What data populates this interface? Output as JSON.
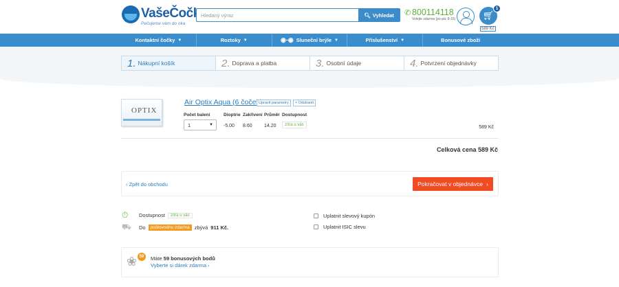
{
  "header": {
    "logo_text": "VašeČočky",
    "logo_tagline": "Pečujeme vám do oka",
    "search_placeholder": "Hledaný výraz",
    "search_button": "Vyhledat",
    "phone_number": "800114118",
    "phone_note": "Volejte zdarma (po-pá: 8-16)",
    "cart_count": "1",
    "cart_price": "589 Kč"
  },
  "nav": {
    "items": [
      "Kontaktní čočky",
      "Roztoky",
      "Sluneční brýle",
      "Příslušenství",
      "Bonusové zboží"
    ]
  },
  "steps": [
    {
      "num": "1.",
      "label": "Nákupní košík"
    },
    {
      "num": "2.",
      "label": "Doprava a platba"
    },
    {
      "num": "3.",
      "label": "Osobní údaje"
    },
    {
      "num": "4.",
      "label": "Potvrzení objednávky"
    }
  ],
  "product": {
    "image_text": "OPTIX",
    "name": "Air Optix Aqua (6 čoček)",
    "edit_label": "Upravit parametry",
    "remove_label": "× Odstranit",
    "labels": {
      "quantity": "Počet balení",
      "dioptrie": "Dioptrie",
      "zakriveni": "Zakřivení",
      "prumer": "Průměr",
      "dostupnost": "Dostupnost"
    },
    "quantity": "1",
    "dioptrie": "-5.00",
    "zakriveni": "8.60",
    "prumer": "14.20",
    "availability": "zítra u vás",
    "price": "589 Kč"
  },
  "total": "Celková cena 589 Kč",
  "actions": {
    "back": "‹ Zpět do obchodu",
    "continue": "Pokračovat v objednávce"
  },
  "info": {
    "availability_label": "Dostupnost",
    "availability_value": "zítra u vás",
    "shipping_prefix": "Do",
    "shipping_highlight": "poštovného zdarma",
    "shipping_suffix": "zbývá",
    "shipping_amount": "911 Kč.",
    "coupon": "Uplatnit slevový kupón",
    "isic": "Uplatnit ISIC slevu"
  },
  "bonus": {
    "count": "59",
    "text_prefix": "Máte",
    "text_bold": "59 bonusových bodů",
    "link": "Vyberte si dárek zdarma ›"
  }
}
